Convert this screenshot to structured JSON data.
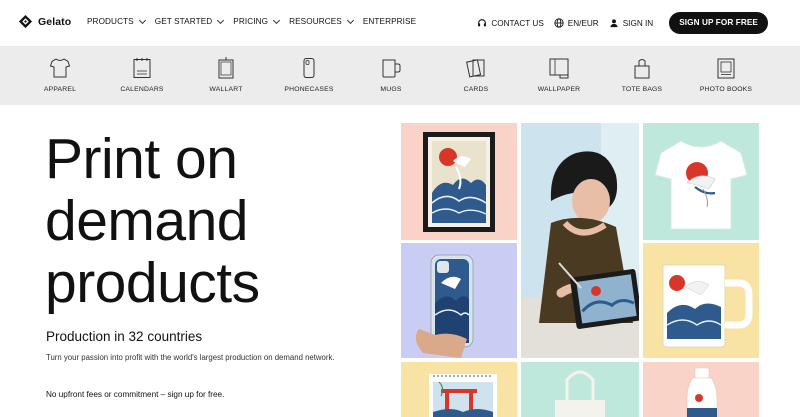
{
  "brand": {
    "name": "Gelato"
  },
  "nav": {
    "items": [
      {
        "label": "PRODUCTS",
        "has_dropdown": true
      },
      {
        "label": "GET STARTED",
        "has_dropdown": true
      },
      {
        "label": "PRICING",
        "has_dropdown": true
      },
      {
        "label": "RESOURCES",
        "has_dropdown": true
      },
      {
        "label": "ENTERPRISE",
        "has_dropdown": false
      }
    ],
    "contact": "CONTACT US",
    "locale": "EN/EUR",
    "signin": "SIGN IN",
    "signup": "SIGN UP FOR FREE"
  },
  "categories": [
    {
      "label": "APPAREL",
      "icon": "tshirt-icon"
    },
    {
      "label": "CALENDARS",
      "icon": "calendar-icon"
    },
    {
      "label": "WALLART",
      "icon": "wallart-icon"
    },
    {
      "label": "PHONECASES",
      "icon": "phonecase-icon"
    },
    {
      "label": "MUGS",
      "icon": "mug-icon"
    },
    {
      "label": "CARDS",
      "icon": "cards-icon"
    },
    {
      "label": "WALLPAPER",
      "icon": "wallpaper-icon"
    },
    {
      "label": "TOTE BAGS",
      "icon": "tote-bag-icon"
    },
    {
      "label": "PHOTO BOOKS",
      "icon": "photo-book-icon"
    }
  ],
  "hero": {
    "title_line1": "Print on",
    "title_line2": "demand",
    "title_line3": "products",
    "subtitle": "Production in 32 countries",
    "description": "Turn your passion into profit with the world's largest production on demand network.",
    "note": "No upfront fees or commitment – sign up for free."
  },
  "colors": {
    "tile_pink": "#f9d2c8",
    "tile_mint": "#bfe8dd",
    "tile_lavender": "#c9cdf4",
    "tile_yellow": "#f8e2a4",
    "accent_red": "#d9362b",
    "wave_blue": "#2e5a8e"
  }
}
